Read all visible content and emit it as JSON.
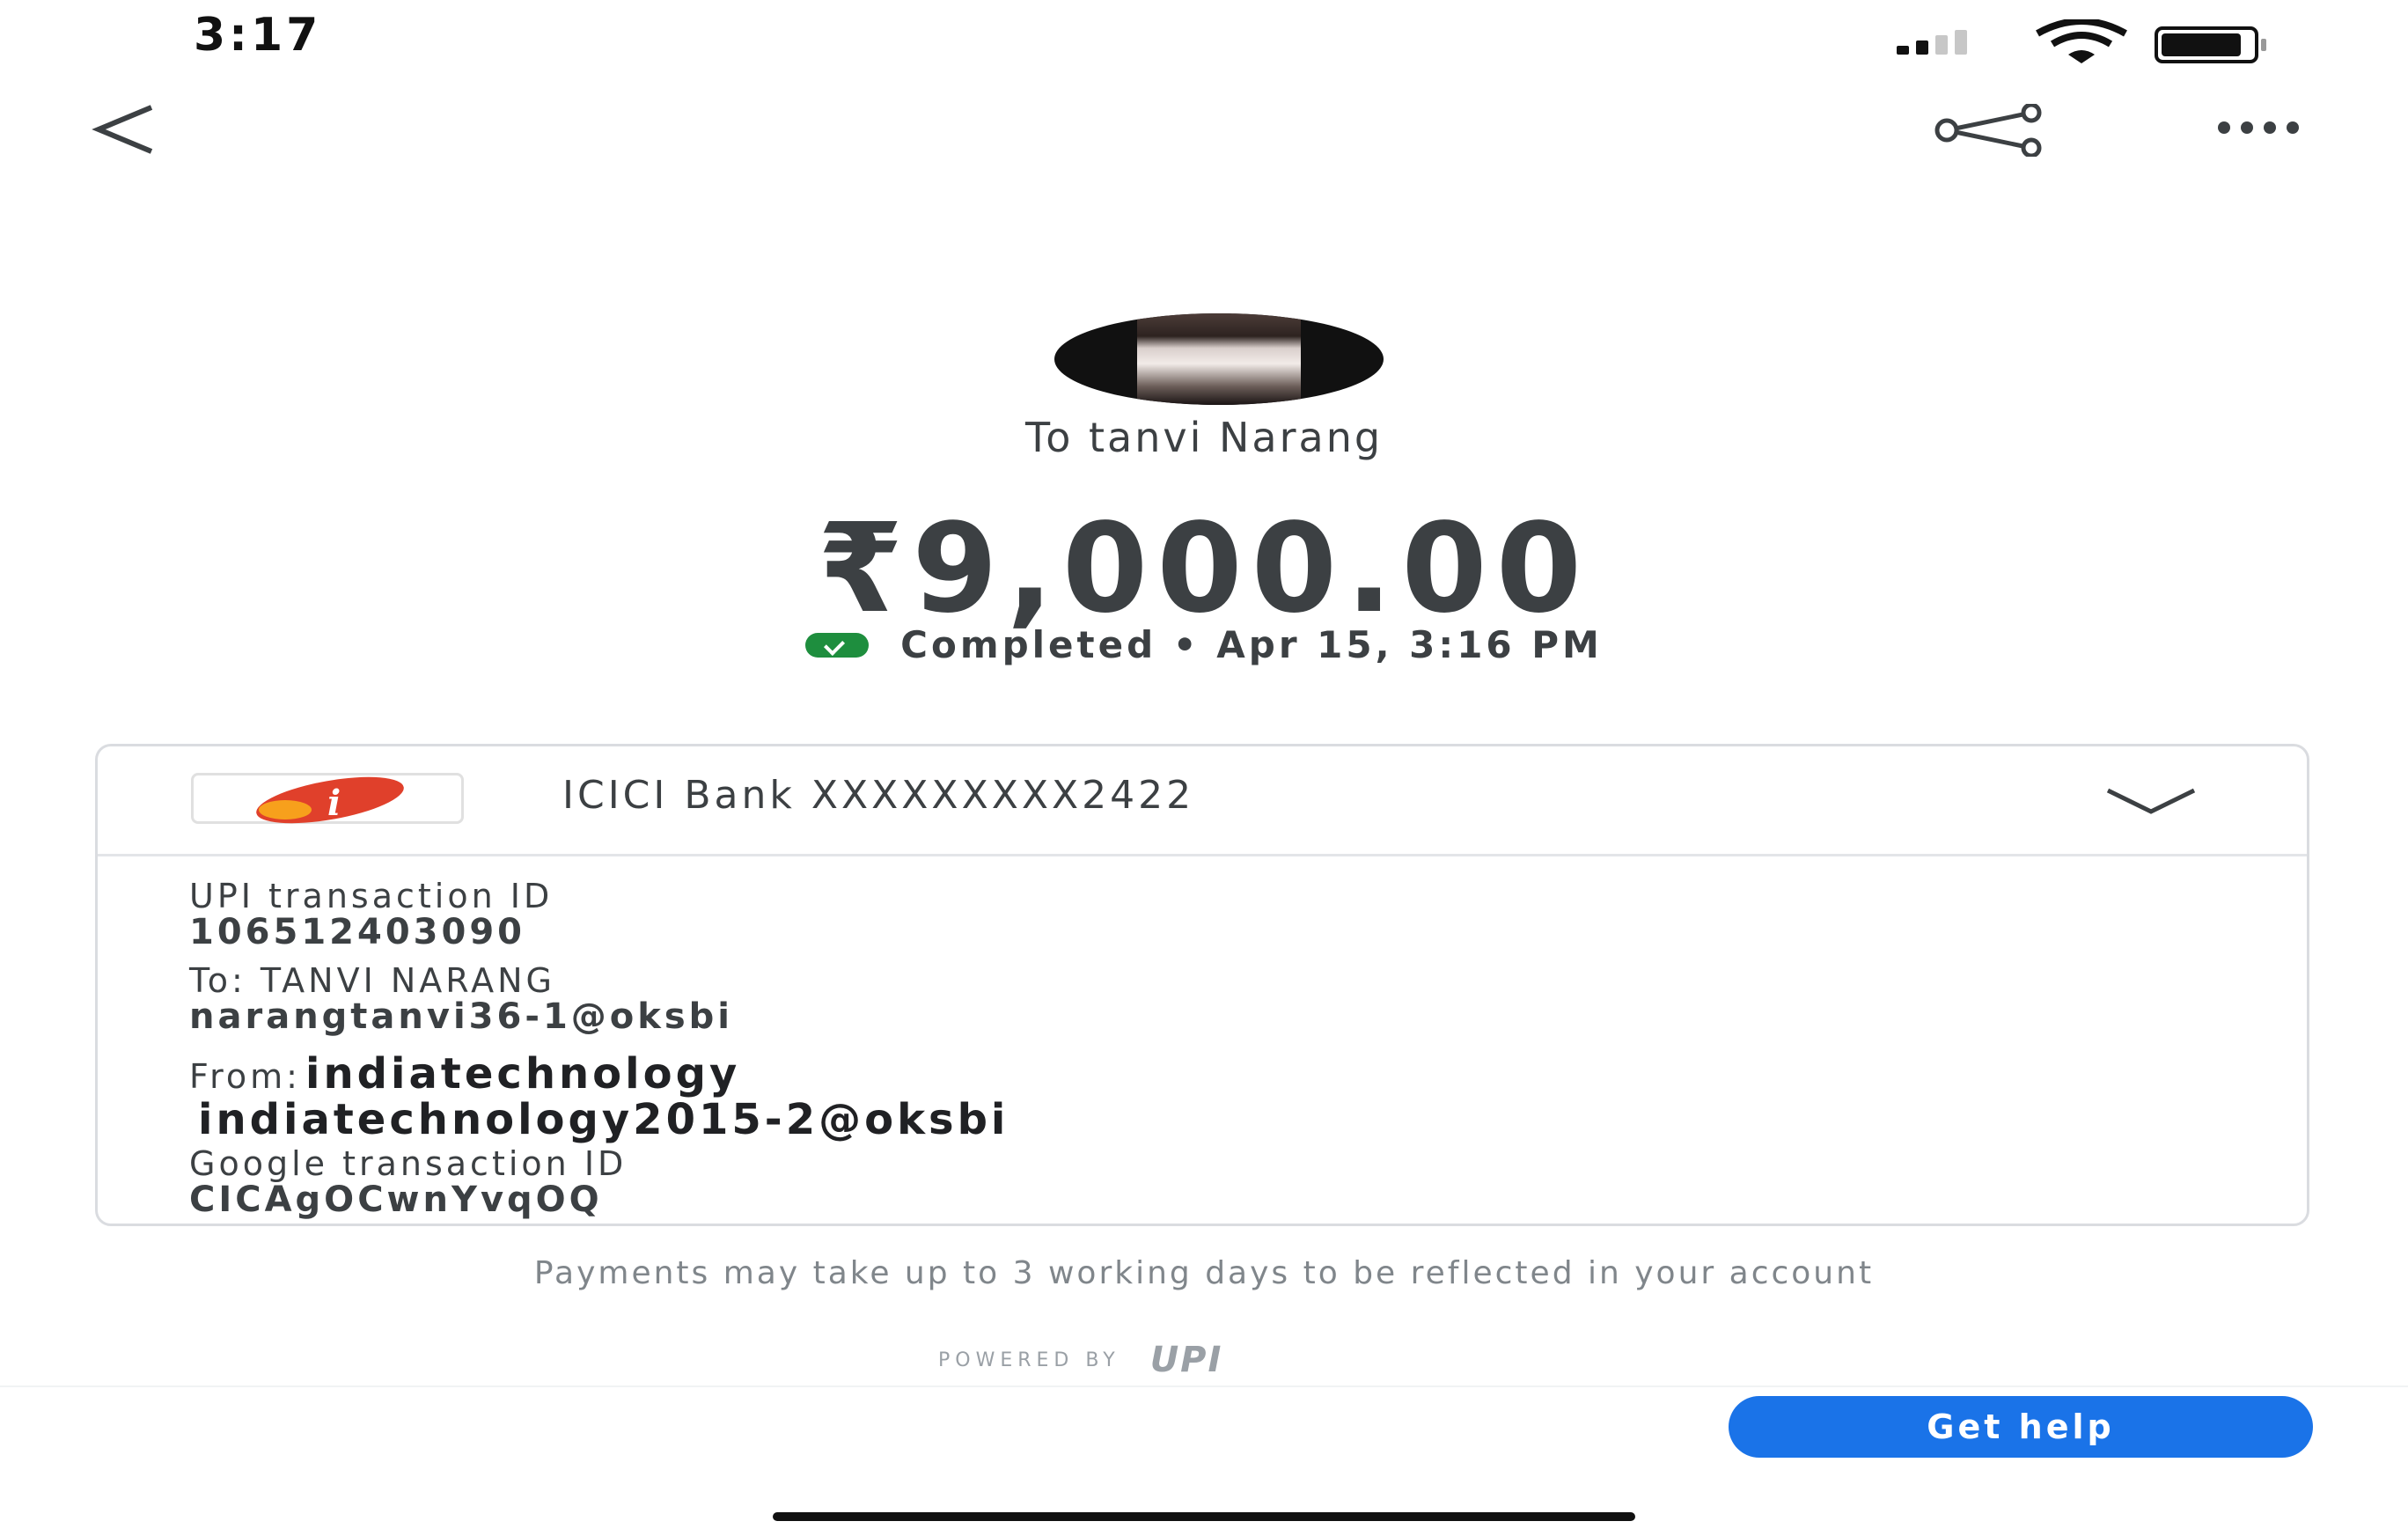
{
  "status_bar": {
    "time": "3:17"
  },
  "header": {
    "back_icon": "chevron-left-icon",
    "share_icon": "share-icon",
    "more_icon": "more-horizontal-icon"
  },
  "recipient": {
    "to_label": "To tanvi Narang"
  },
  "payment": {
    "amount": "₹9,000.00",
    "status": "Completed • Apr 15, 3:16 PM",
    "status_color": "#1e8e3e"
  },
  "card": {
    "bank_name": "ICICI Bank XXXXXXXXX2422",
    "upi_id_label": "UPI transaction ID",
    "upi_id_value": "106512403090",
    "to_label": "To: TANVI NARANG",
    "to_vpa": "narangtanvi36-1@oksbi",
    "from_label": "From:",
    "from_name": "indiatechnology",
    "from_vpa": "indiatechnology2015-2@oksbi",
    "google_id_label": "Google transaction ID",
    "google_id_value": "CICAgOCwnYvqOQ"
  },
  "footer": {
    "note": "Payments may take up to 3 working days to be reflected in your account",
    "powered_by": "POWERED BY",
    "upi_logo": "UPI",
    "help_label": "Get help",
    "accent": "#1a73e8"
  }
}
